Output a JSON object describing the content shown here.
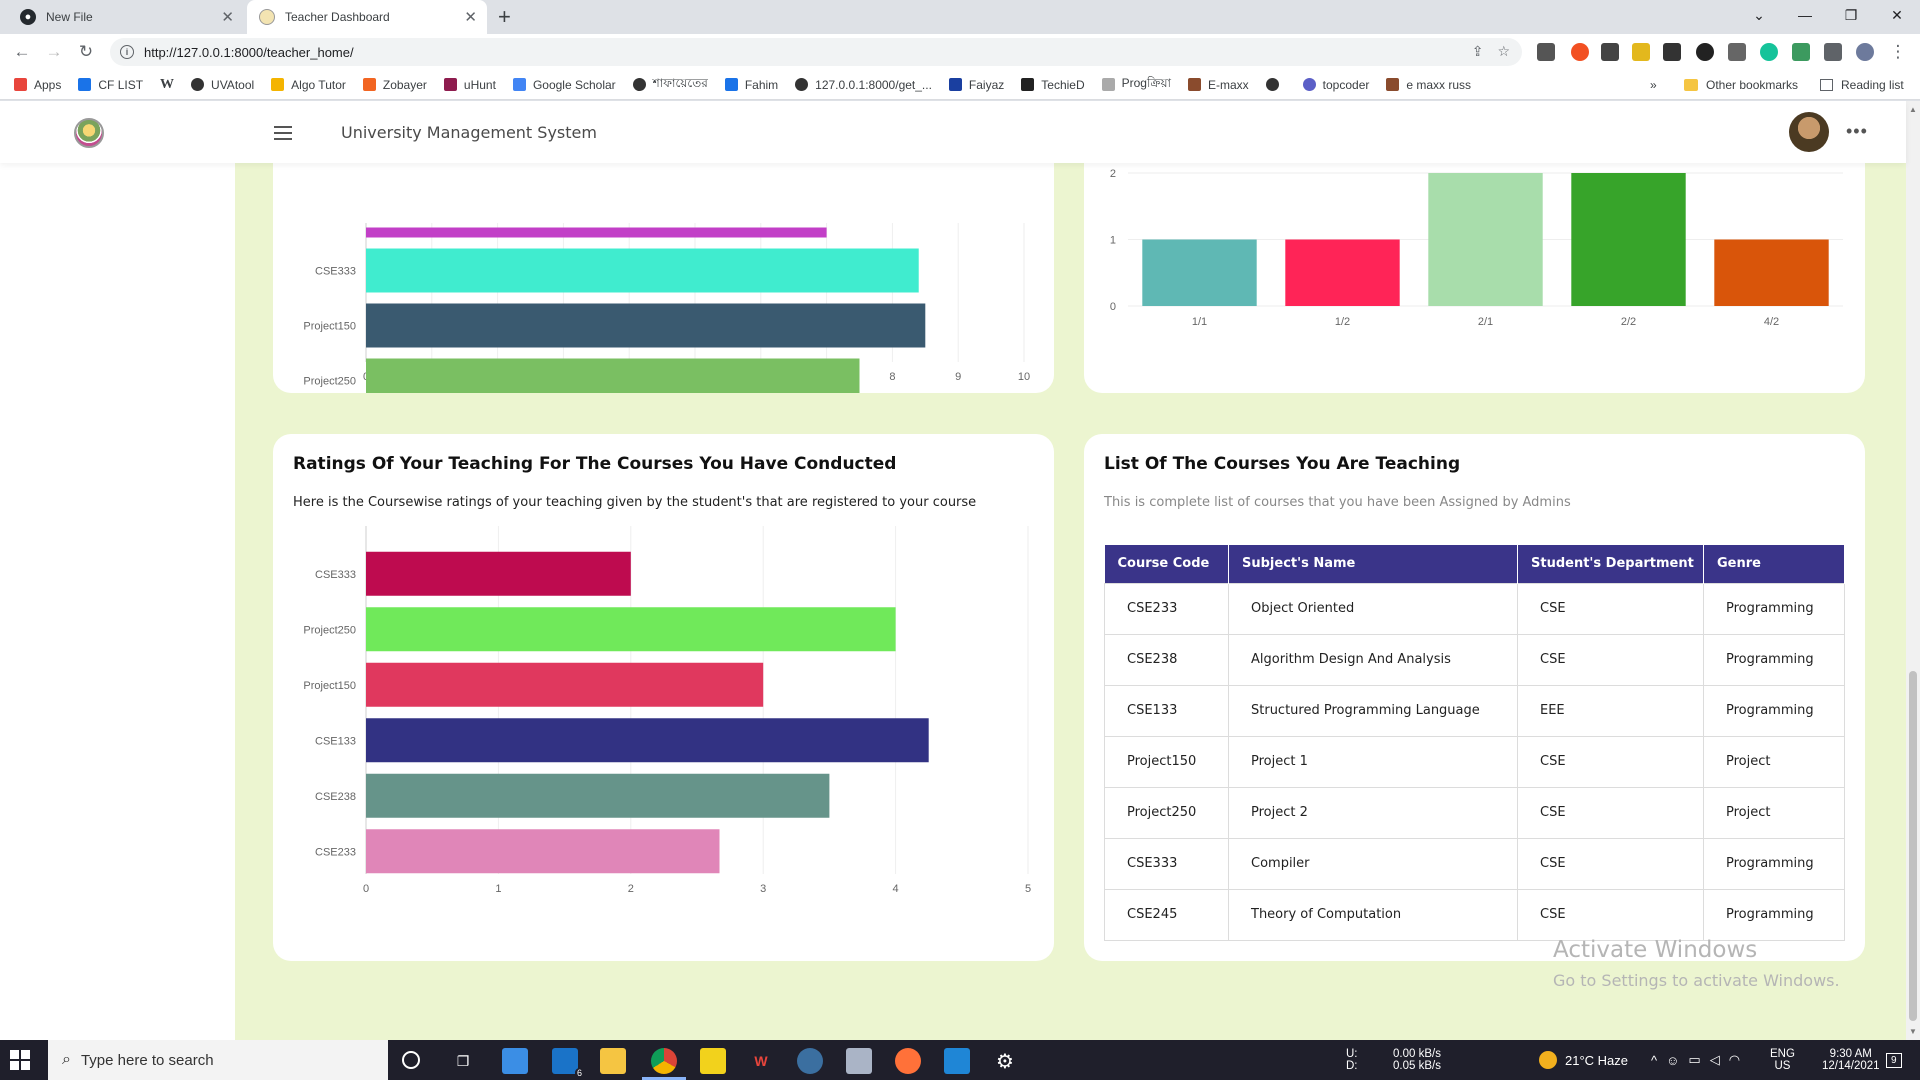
{
  "browser": {
    "tabs": [
      {
        "title": "New File",
        "active": false
      },
      {
        "title": "Teacher Dashboard",
        "active": true
      }
    ],
    "url": "http://127.0.0.1:8000/teacher_home/",
    "bookmarks": [
      {
        "label": "Apps",
        "color": "#e8453c"
      },
      {
        "label": "CF LIST",
        "color": "#1a73e8"
      },
      {
        "label": "",
        "color": "#222"
      },
      {
        "label": "UVAtool",
        "color": "#333"
      },
      {
        "label": "Algo Tutor",
        "color": "#f4b400"
      },
      {
        "label": "Zobayer",
        "color": "#f26522"
      },
      {
        "label": "uHunt",
        "color": "#8e1c4e"
      },
      {
        "label": "Google Scholar",
        "color": "#4285f4"
      },
      {
        "label": "শাফায়েতের",
        "color": "#333"
      },
      {
        "label": "Fahim",
        "color": "#1a73e8"
      },
      {
        "label": "127.0.0.1:8000/get_...",
        "color": "#333"
      },
      {
        "label": "Faiyaz",
        "color": "#1a3fa0"
      },
      {
        "label": "TechieD",
        "color": "#222"
      },
      {
        "label": "Progক্রিয়া",
        "color": "#777"
      },
      {
        "label": "E-maxx",
        "color": "#8a4b2d"
      },
      {
        "label": "",
        "color": "#333"
      },
      {
        "label": "topcoder",
        "color": "#5b5fc7"
      },
      {
        "label": "e maxx russ",
        "color": "#8a4b2d"
      }
    ],
    "other_bookmarks": "Other bookmarks",
    "reading_list": "Reading list",
    "overflow": "»"
  },
  "app": {
    "title": "University Management System"
  },
  "top_left_chart": {
    "chart_data": {
      "type": "bar",
      "orientation": "horizontal",
      "categories": [
        "CSE333",
        "Project150",
        "Project250"
      ],
      "values": [
        8.4,
        8.5,
        7.5
      ],
      "colors": [
        "#40eccf",
        "#3a5a70",
        "#7abf62"
      ],
      "partial_bar_above": {
        "value": 7.0,
        "color": "#c23fc7"
      },
      "xlim": [
        0,
        10
      ],
      "xticks": [
        "0",
        "1",
        "2",
        "3",
        "4",
        "5",
        "6",
        "7",
        "8",
        "9",
        "10"
      ]
    }
  },
  "top_right_chart": {
    "chart_data": {
      "type": "bar",
      "categories": [
        "1/1",
        "1/2",
        "2/1",
        "2/2",
        "4/2"
      ],
      "values": [
        1,
        1,
        2,
        2,
        1
      ],
      "colors": [
        "#5fb8b4",
        "#ff2457",
        "#a8ddab",
        "#37a42a",
        "#d9550a"
      ],
      "ylim": [
        0,
        2
      ],
      "yticks": [
        "0",
        "1",
        "2"
      ]
    }
  },
  "ratings": {
    "title": "Ratings Of Your Teaching For The Courses You Have Conducted",
    "subtitle": "Here is the Coursewise ratings of your teaching given by the student's that are registered to your course",
    "chart_data": {
      "type": "bar",
      "orientation": "horizontal",
      "categories": [
        "CSE333",
        "Project250",
        "Project150",
        "CSE133",
        "CSE238",
        "CSE233"
      ],
      "values": [
        2.0,
        4.0,
        3.0,
        4.25,
        3.5,
        2.67
      ],
      "colors": [
        "#be0b4f",
        "#70e95a",
        "#e0385e",
        "#323283",
        "#66948a",
        "#e086b8"
      ],
      "xlim": [
        0,
        5
      ],
      "xticks": [
        "0",
        "1",
        "2",
        "3",
        "4",
        "5"
      ]
    }
  },
  "courses": {
    "title": "List Of The Courses You Are Teaching",
    "subtitle": "This is complete list of courses that you have been Assigned by Admins",
    "headers": [
      "Course Code",
      "Subject's Name",
      "Student's Department",
      "Genre"
    ],
    "rows": [
      [
        "CSE233",
        "Object Oriented",
        "CSE",
        "Programming"
      ],
      [
        "CSE238",
        "Algorithm Design And Analysis",
        "CSE",
        "Programming"
      ],
      [
        "CSE133",
        "Structured Programming Language",
        "EEE",
        "Programming"
      ],
      [
        "Project150",
        "Project 1",
        "CSE",
        "Project"
      ],
      [
        "Project250",
        "Project 2",
        "CSE",
        "Project"
      ],
      [
        "CSE333",
        "Compiler",
        "CSE",
        "Programming"
      ],
      [
        "CSE245",
        "Theory of Computation",
        "CSE",
        "Programming"
      ]
    ]
  },
  "watermark": {
    "line1": "Activate Windows",
    "line2": "Go to Settings to activate Windows."
  },
  "taskbar": {
    "search_placeholder": "Type here to search",
    "mail_badge": "6",
    "net_up_label": "U:",
    "net_down_label": "D:",
    "net_up": "0.00 kB/s",
    "net_down": "0.05 kB/s",
    "weather": "21°C  Haze",
    "lang1": "ENG",
    "lang2": "US",
    "time": "9:30 AM",
    "date": "12/14/2021",
    "notif_count": "9"
  }
}
